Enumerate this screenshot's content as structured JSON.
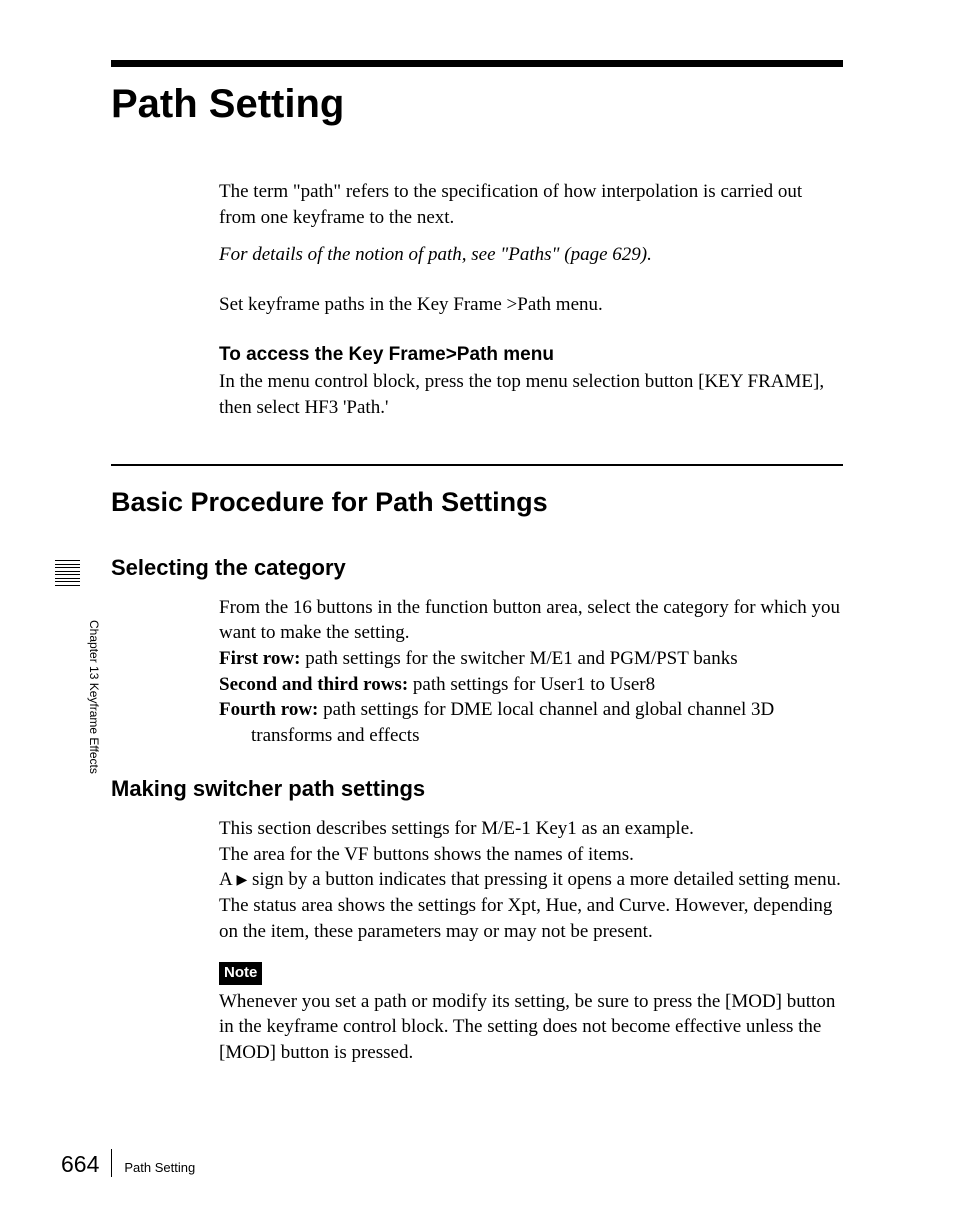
{
  "side": {
    "chapter": "Chapter 13  Keyframe Effects"
  },
  "header": {
    "title": "Path Setting"
  },
  "intro": {
    "p1": "The term \"path\" refers to the specification of how interpolation is carried out from one keyframe to the next.",
    "p2": "For details of the notion of path, see \"Paths\" (page 629).",
    "p3": "Set keyframe paths in the Key Frame >Path menu."
  },
  "access": {
    "heading": "To access the Key Frame>Path menu",
    "body": "In the menu control block, press the top menu selection button [KEY FRAME], then select HF3 'Path.'"
  },
  "section": {
    "title": "Basic Procedure for Path Settings"
  },
  "selecting": {
    "title": "Selecting the category",
    "intro": "From the 16 buttons in the function button area, select the category for which you want to make the setting.",
    "row1_label": "First row:",
    "row1_text": " path settings for the switcher M/E1 and PGM/PST banks",
    "row2_label": "Second and third rows:",
    "row2_text": " path settings for User1 to User8",
    "row4_label": "Fourth row:",
    "row4_text": " path settings for DME local channel and global channel 3D transforms and effects"
  },
  "making": {
    "title": "Making switcher path settings",
    "p1": "This section describes settings for M/E-1 Key1 as an example.",
    "p2": "The area for the VF buttons shows the names of items.",
    "p3a": "A ",
    "p3b": " sign by a button indicates that pressing it opens a more detailed setting menu.",
    "p4": "The status area shows the settings for Xpt, Hue, and Curve. However, depending on the item, these parameters may or may not be present."
  },
  "note": {
    "label": "Note",
    "body": "Whenever you set a path or modify its setting, be sure to press the [MOD] button in the keyframe control block. The setting does not become effective unless the [MOD] button is pressed."
  },
  "footer": {
    "page": "664",
    "title": "Path Setting"
  }
}
